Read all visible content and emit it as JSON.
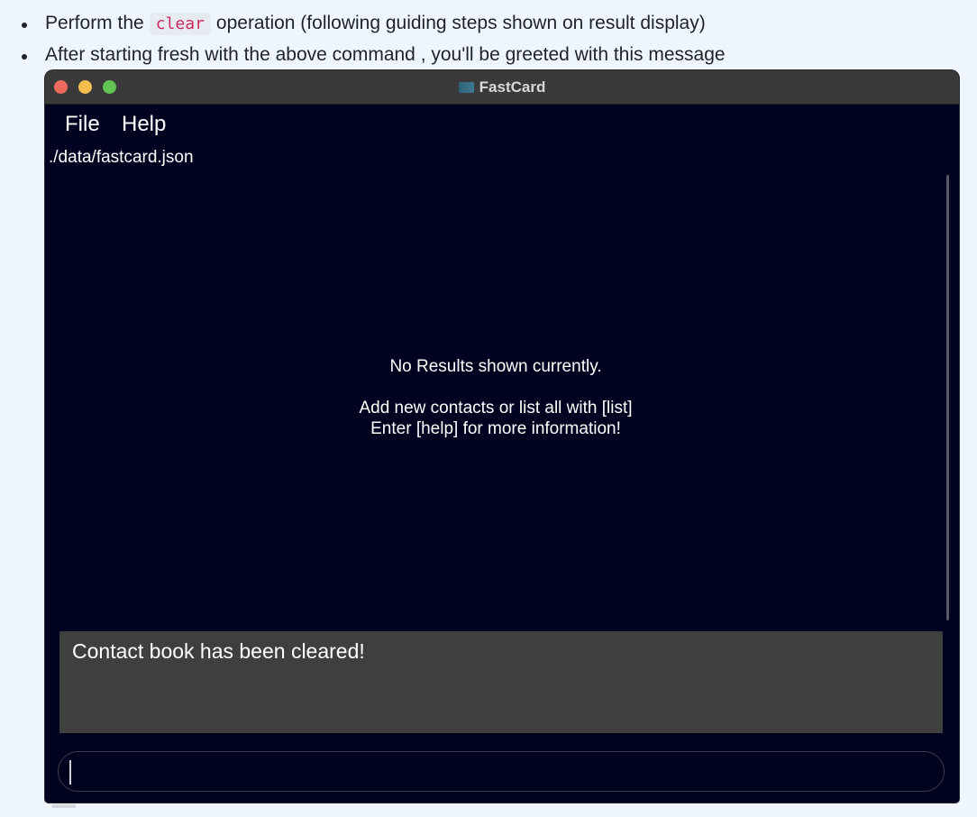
{
  "doc": {
    "bullets": [
      {
        "before": "Perform the",
        "code": "clear",
        "after": "operation (following guiding steps shown on result display)"
      },
      {
        "text": "After starting fresh with the above command , you'll be greeted with this message"
      }
    ]
  },
  "window": {
    "title": "FastCard",
    "app_icon": "fastcard-app-icon",
    "traffic_lights": {
      "close": "#ed6a5e",
      "minimize": "#f5bf4f",
      "maximize": "#61c454"
    }
  },
  "menu": {
    "file": "File",
    "help": "Help"
  },
  "status": {
    "file_path": "./data/fastcard.json"
  },
  "list_panel": {
    "empty_line1": "No Results shown currently.",
    "empty_line2": "Add new contacts or list all with [list]",
    "empty_line3": "Enter [help] for more information!"
  },
  "result_display": {
    "text": "Contact book has been cleared!"
  },
  "command_box": {
    "value": "",
    "placeholder": ""
  },
  "colors": {
    "page_bg": "#eff5fe",
    "window_bg": "#00031f",
    "titlebar_bg": "#3a3a3a",
    "result_bg": "#3f3f3f",
    "code_text": "#cf2a5a"
  }
}
